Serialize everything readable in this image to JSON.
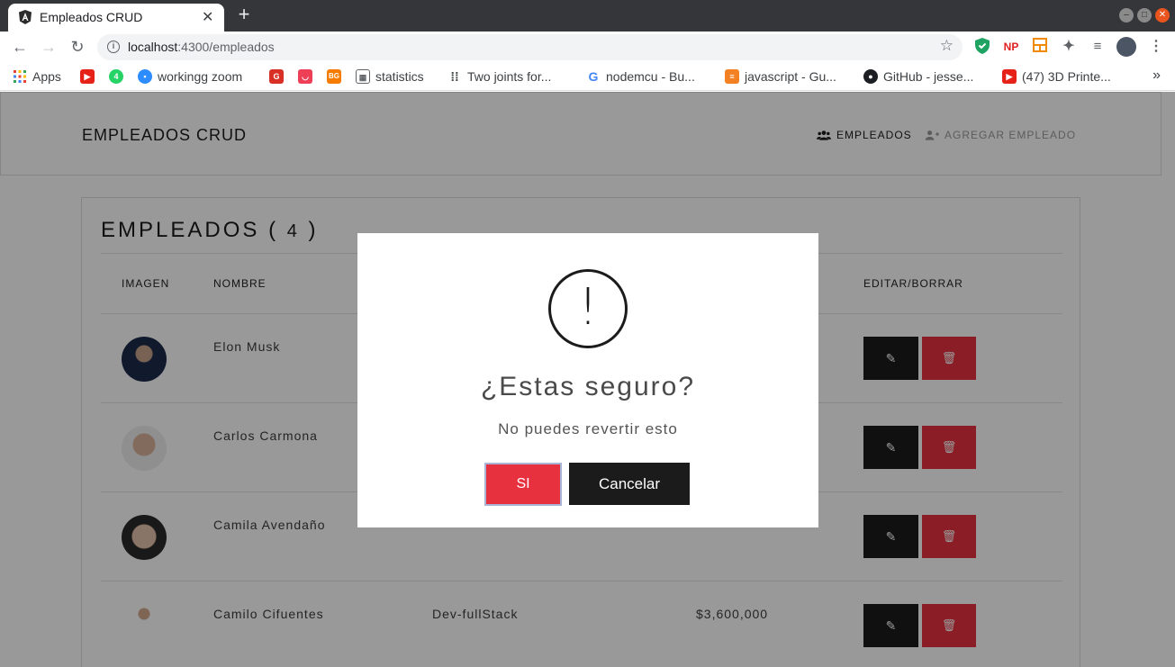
{
  "browser": {
    "tab_title": "Empleados CRUD",
    "tab_close": "✕",
    "new_tab": "+",
    "url_host": "localhost",
    "url_port_path": ":4300/empleados",
    "extensions": [
      "NP"
    ]
  },
  "bookmarks": [
    {
      "label": "Apps",
      "icon": "apps-grid-icon"
    },
    {
      "label": "",
      "icon": "youtube-icon"
    },
    {
      "label": "",
      "icon": "whatsapp-icon"
    },
    {
      "label": "workingg zoom",
      "icon": "zoom-icon"
    },
    {
      "label": "",
      "icon": "bookmark-red-icon"
    },
    {
      "label": "",
      "icon": "pocket-icon"
    },
    {
      "label": "",
      "icon": "bg-icon",
      "text": "BG"
    },
    {
      "label": "statistics",
      "icon": "calculator-icon"
    },
    {
      "label": "Two joints for...",
      "icon": "dots-grid-icon"
    },
    {
      "label": "nodemcu - Bu...",
      "icon": "google-icon"
    },
    {
      "label": "javascript - Gu...",
      "icon": "stackoverflow-icon"
    },
    {
      "label": "GitHub - jesse...",
      "icon": "github-icon"
    },
    {
      "label": "(47) 3D Printe...",
      "icon": "youtube-icon"
    }
  ],
  "navbar": {
    "brand": "EMPLEADOS CRUD",
    "link_empleados": "EMPLEADOS",
    "link_agregar": "AGREGAR EMPLEADO"
  },
  "list": {
    "title": "EMPLEADOS",
    "count_open": "(",
    "count": "4",
    "count_close": ")",
    "headers": {
      "imagen": "IMAGEN",
      "nombre": "NOMBRE",
      "acciones": "EDITAR/BORRAR"
    },
    "rows": [
      {
        "nombre": "Elon Musk",
        "cargo": "",
        "salario": ""
      },
      {
        "nombre": "Carlos Carmona",
        "cargo": "",
        "salario": ""
      },
      {
        "nombre": "Camila Avendaño",
        "cargo": "",
        "salario": ""
      },
      {
        "nombre": "Camilo Cifuentes",
        "cargo": "Dev-fullStack",
        "salario": "$3,600,000"
      }
    ]
  },
  "modal": {
    "icon": "!",
    "title": "¿Estas seguro?",
    "text": "No puedes revertir esto",
    "confirm_label": "SI",
    "cancel_label": "Cancelar"
  },
  "colors": {
    "danger": "#e7313f",
    "dark": "#1b1b1b",
    "overlay": "rgba(0,0,0,0.4)"
  }
}
